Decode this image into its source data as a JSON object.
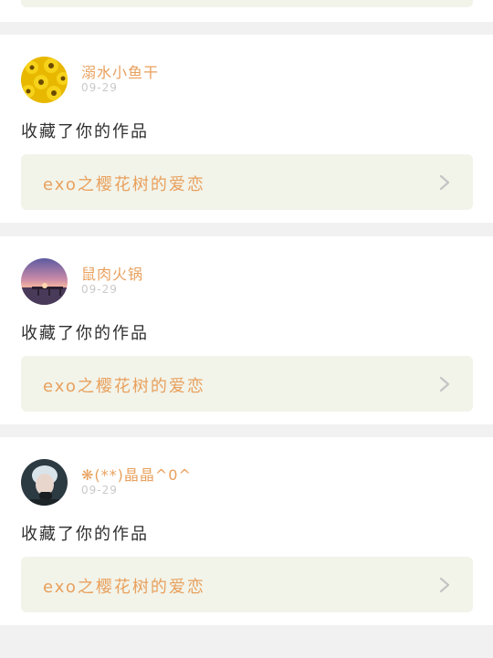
{
  "feed": {
    "items": [
      {
        "username": "溺水小鱼干",
        "timestamp": "09-29",
        "action": "收藏了你的作品",
        "work_title": "exo之樱花树的爱恋",
        "avatar_icon": "sunflower-avatar"
      },
      {
        "username": "鼠肉火锅",
        "timestamp": "09-29",
        "action": "收藏了你的作品",
        "work_title": "exo之樱花树的爱恋",
        "avatar_icon": "sunset-pier-avatar"
      },
      {
        "username": "❋(**)晶晶^0^",
        "timestamp": "09-29",
        "action": "收藏了你的作品",
        "work_title": "exo之樱花树的爱恋",
        "avatar_icon": "person-portrait-avatar"
      }
    ]
  },
  "colors": {
    "accent": "#e8a05d",
    "card_link_bg": "#f2f4ea",
    "page_bg": "#f1f1f1",
    "timestamp": "#c9c9c9",
    "body_text": "#2f2f2f"
  }
}
